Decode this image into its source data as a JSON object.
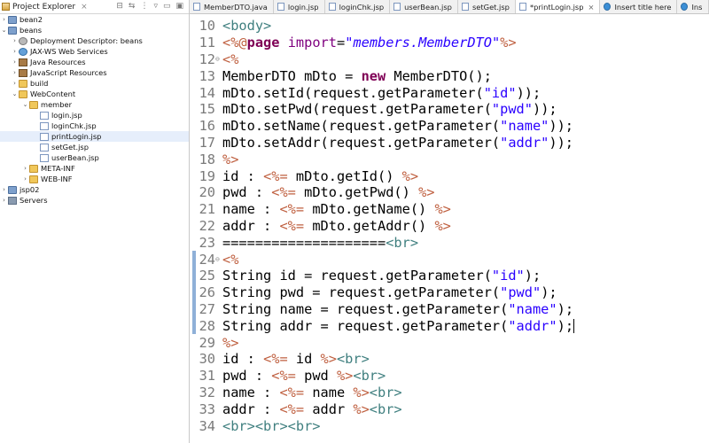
{
  "explorer": {
    "title": "Project Explorer",
    "close_label": "⨯",
    "tree": [
      {
        "label": "bean2",
        "twisty": "›",
        "icon": "project-icon",
        "depth": 0
      },
      {
        "label": "beans",
        "twisty": "⌄",
        "icon": "project-icon",
        "depth": 0
      },
      {
        "label": "Deployment Descriptor: beans",
        "twisty": "›",
        "icon": "gear-icon",
        "depth": 1
      },
      {
        "label": "JAX-WS Web Services",
        "twisty": "›",
        "icon": "web-icon",
        "depth": 1
      },
      {
        "label": "Java Resources",
        "twisty": "›",
        "icon": "lib-icon",
        "depth": 1
      },
      {
        "label": "JavaScript Resources",
        "twisty": "›",
        "icon": "lib-icon",
        "depth": 1
      },
      {
        "label": "build",
        "twisty": "›",
        "icon": "folder-icon",
        "depth": 1
      },
      {
        "label": "WebContent",
        "twisty": "⌄",
        "icon": "folder-icon",
        "depth": 1
      },
      {
        "label": "member",
        "twisty": "⌄",
        "icon": "folder-icon",
        "depth": 2
      },
      {
        "label": "login.jsp",
        "twisty": "",
        "icon": "jsp-file-icon",
        "depth": 3
      },
      {
        "label": "loginChk.jsp",
        "twisty": "",
        "icon": "jsp-file-icon",
        "depth": 3
      },
      {
        "label": "printLogin.jsp",
        "twisty": "",
        "icon": "jsp-file-icon",
        "depth": 3
      },
      {
        "label": "setGet.jsp",
        "twisty": "",
        "icon": "jsp-file-icon",
        "depth": 3
      },
      {
        "label": "userBean.jsp",
        "twisty": "",
        "icon": "jsp-file-icon",
        "depth": 3
      },
      {
        "label": "META-INF",
        "twisty": "›",
        "icon": "folder-icon",
        "depth": 2
      },
      {
        "label": "WEB-INF",
        "twisty": "›",
        "icon": "folder-icon",
        "depth": 2
      },
      {
        "label": "jsp02",
        "twisty": "›",
        "icon": "project-icon",
        "depth": 0
      },
      {
        "label": "Servers",
        "twisty": "›",
        "icon": "server-icon",
        "depth": 0
      }
    ]
  },
  "tabs": [
    {
      "label": "MemberDTO.java",
      "active": false
    },
    {
      "label": "login.jsp",
      "active": false
    },
    {
      "label": "loginChk.jsp",
      "active": false
    },
    {
      "label": "userBean.jsp",
      "active": false
    },
    {
      "label": "setGet.jsp",
      "active": false
    },
    {
      "label": "*printLogin.jsp",
      "active": true
    },
    {
      "label": "Insert title here",
      "active": false,
      "globe": true
    },
    {
      "label": "Ins",
      "active": false,
      "globe": true
    }
  ],
  "editor": {
    "lines": [
      {
        "n": "10",
        "fold": "",
        "tokens": [
          [
            "tag",
            "<body>"
          ]
        ]
      },
      {
        "n": "11",
        "fold": "",
        "tokens": [
          [
            "delim",
            "<%@"
          ],
          [
            "kw",
            "page"
          ],
          [
            "plain",
            " "
          ],
          [
            "attr",
            "import"
          ],
          [
            "plain",
            "="
          ],
          [
            "attrval",
            "\"members.MemberDTO\""
          ],
          [
            "delim",
            "%>"
          ]
        ]
      },
      {
        "n": "12",
        "fold": "⊖",
        "tokens": [
          [
            "delim",
            "<%"
          ]
        ]
      },
      {
        "n": "13",
        "fold": "",
        "tokens": [
          [
            "plain",
            "MemberDTO mDto = "
          ],
          [
            "kw",
            "new"
          ],
          [
            "plain",
            " MemberDTO();"
          ]
        ]
      },
      {
        "n": "14",
        "fold": "",
        "tokens": [
          [
            "plain",
            "mDto.setId(request.getParameter("
          ],
          [
            "str",
            "\"id\""
          ],
          [
            "plain",
            "));"
          ]
        ]
      },
      {
        "n": "15",
        "fold": "",
        "tokens": [
          [
            "plain",
            "mDto.setPwd(request.getParameter("
          ],
          [
            "str",
            "\"pwd\""
          ],
          [
            "plain",
            "));"
          ]
        ]
      },
      {
        "n": "16",
        "fold": "",
        "tokens": [
          [
            "plain",
            "mDto.setName(request.getParameter("
          ],
          [
            "str",
            "\"name\""
          ],
          [
            "plain",
            "));"
          ]
        ]
      },
      {
        "n": "17",
        "fold": "",
        "tokens": [
          [
            "plain",
            "mDto.setAddr(request.getParameter("
          ],
          [
            "str",
            "\"addr\""
          ],
          [
            "plain",
            "));"
          ]
        ]
      },
      {
        "n": "18",
        "fold": "",
        "tokens": [
          [
            "delim",
            "%>"
          ]
        ]
      },
      {
        "n": "19",
        "fold": "",
        "tokens": [
          [
            "plain",
            "id : "
          ],
          [
            "delim",
            "<%="
          ],
          [
            "plain",
            " mDto.getId() "
          ],
          [
            "delim",
            "%>"
          ]
        ]
      },
      {
        "n": "20",
        "fold": "",
        "tokens": [
          [
            "plain",
            "pwd : "
          ],
          [
            "delim",
            "<%="
          ],
          [
            "plain",
            " mDto.getPwd() "
          ],
          [
            "delim",
            "%>"
          ]
        ]
      },
      {
        "n": "21",
        "fold": "",
        "tokens": [
          [
            "plain",
            "name : "
          ],
          [
            "delim",
            "<%="
          ],
          [
            "plain",
            " mDto.getName() "
          ],
          [
            "delim",
            "%>"
          ]
        ]
      },
      {
        "n": "22",
        "fold": "",
        "tokens": [
          [
            "plain",
            "addr : "
          ],
          [
            "delim",
            "<%="
          ],
          [
            "plain",
            " mDto.getAddr() "
          ],
          [
            "delim",
            "%>"
          ]
        ]
      },
      {
        "n": "23",
        "fold": "",
        "tokens": [
          [
            "plain",
            "===================="
          ],
          [
            "tag",
            "<br>"
          ]
        ]
      },
      {
        "n": "24",
        "fold": "⊖",
        "tokens": [
          [
            "delim",
            "<%"
          ]
        ]
      },
      {
        "n": "25",
        "fold": "",
        "tokens": [
          [
            "plain",
            "String id = request.getParameter("
          ],
          [
            "str",
            "\"id\""
          ],
          [
            "plain",
            ");"
          ]
        ]
      },
      {
        "n": "26",
        "fold": "",
        "tokens": [
          [
            "plain",
            "String pwd = request.getParameter("
          ],
          [
            "str",
            "\"pwd\""
          ],
          [
            "plain",
            ");"
          ]
        ]
      },
      {
        "n": "27",
        "fold": "",
        "tokens": [
          [
            "plain",
            "String name = request.getParameter("
          ],
          [
            "str",
            "\"name\""
          ],
          [
            "plain",
            ");"
          ]
        ]
      },
      {
        "n": "28",
        "fold": "",
        "tokens": [
          [
            "plain",
            "String addr = request.getParameter("
          ],
          [
            "str",
            "\"addr\""
          ],
          [
            "plain",
            ");"
          ]
        ],
        "cursor": true
      },
      {
        "n": "29",
        "fold": "",
        "tokens": [
          [
            "delim",
            "%>"
          ]
        ]
      },
      {
        "n": "30",
        "fold": "",
        "tokens": [
          [
            "plain",
            "id : "
          ],
          [
            "delim",
            "<%="
          ],
          [
            "plain",
            " id "
          ],
          [
            "delim",
            "%>"
          ],
          [
            "tag",
            "<br>"
          ]
        ]
      },
      {
        "n": "31",
        "fold": "",
        "tokens": [
          [
            "plain",
            "pwd : "
          ],
          [
            "delim",
            "<%="
          ],
          [
            "plain",
            " pwd "
          ],
          [
            "delim",
            "%>"
          ],
          [
            "tag",
            "<br>"
          ]
        ]
      },
      {
        "n": "32",
        "fold": "",
        "tokens": [
          [
            "plain",
            "name : "
          ],
          [
            "delim",
            "<%="
          ],
          [
            "plain",
            " name "
          ],
          [
            "delim",
            "%>"
          ],
          [
            "tag",
            "<br>"
          ]
        ]
      },
      {
        "n": "33",
        "fold": "",
        "tokens": [
          [
            "plain",
            "addr : "
          ],
          [
            "delim",
            "<%="
          ],
          [
            "plain",
            " addr "
          ],
          [
            "delim",
            "%>"
          ],
          [
            "tag",
            "<br>"
          ]
        ]
      },
      {
        "n": "34",
        "fold": "",
        "tokens": [
          [
            "tag",
            "<br><br><br>"
          ]
        ]
      }
    ]
  }
}
